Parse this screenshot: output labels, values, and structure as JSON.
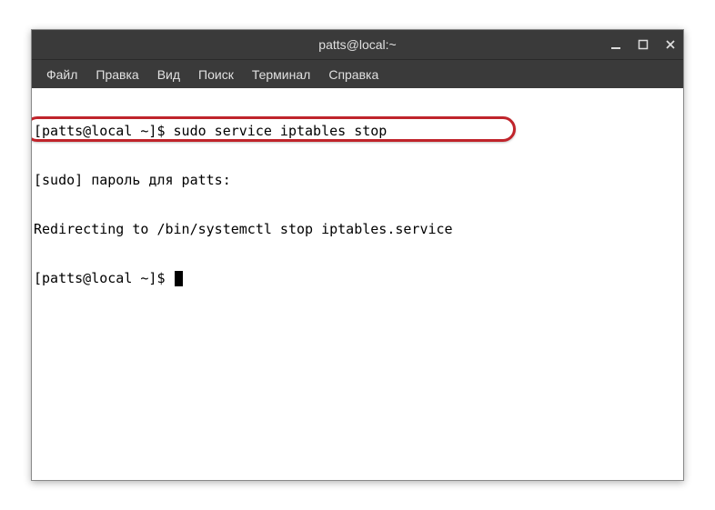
{
  "title": "patts@local:~",
  "menu": {
    "file": "Файл",
    "edit": "Правка",
    "view": "Вид",
    "search": "Поиск",
    "terminal": "Терминал",
    "help": "Справка"
  },
  "terminal": {
    "line1": "[patts@local ~]$ sudo service iptables stop",
    "line2": "[sudo] пароль для patts:",
    "line3": "Redirecting to /bin/systemctl stop iptables.service",
    "line4": "[patts@local ~]$ "
  }
}
